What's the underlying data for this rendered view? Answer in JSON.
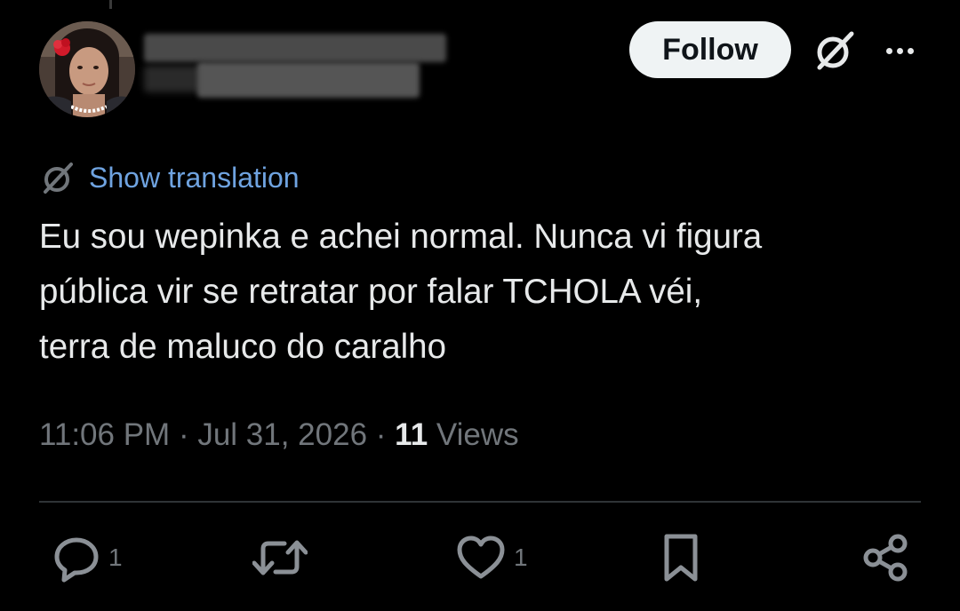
{
  "header": {
    "follow_label": "Follow"
  },
  "icons": {
    "avatar": "avatar",
    "grok": "grok-icon",
    "more": "more-options-icon",
    "translate": "translate-icon",
    "reply": "reply-icon",
    "retweet": "retweet-icon",
    "like": "heart-icon",
    "bookmark": "bookmark-icon",
    "share": "share-icon"
  },
  "tweet": {
    "translate_label": "Show translation",
    "text": "Eu sou wepinka e achei normal. Nunca vi figura\npública vir se retratar por falar TCHOLA véi,\nterra de maluco do caralho",
    "time": "11:06 PM",
    "sep1": " · ",
    "date": "Jul 31, 2026",
    "sep2": " · ",
    "views_count": "11",
    "views_label": " Views"
  },
  "actions": {
    "reply_count": "1",
    "like_count": "1"
  },
  "colors": {
    "background": "#000000",
    "text": "#e7e9ea",
    "muted": "#71767b",
    "link": "#6fa3e0",
    "follow_bg": "#eff3f4"
  }
}
